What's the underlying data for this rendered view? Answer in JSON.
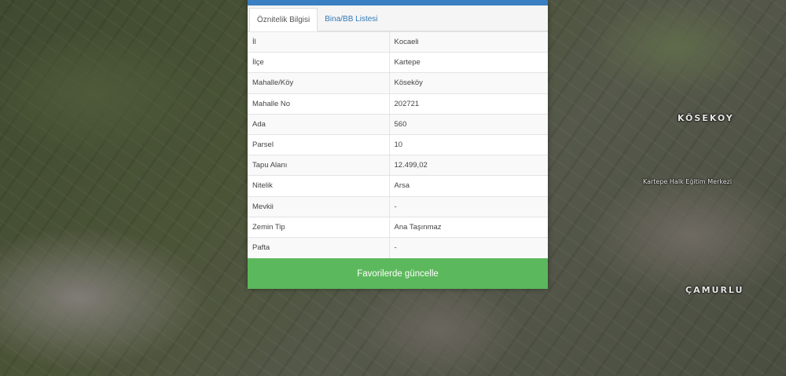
{
  "map": {
    "labels": [
      "KÖSEKOY",
      "ÇAMURLU",
      "Kartepe Halk Eğitim Merkezi"
    ]
  },
  "tabs": [
    {
      "label": "Öznitelik Bilgisi",
      "active": true
    },
    {
      "label": "Bina/BB Listesi",
      "active": false
    }
  ],
  "attributes": [
    {
      "key": "İl",
      "value": "Kocaeli"
    },
    {
      "key": "İlçe",
      "value": "Kartepe"
    },
    {
      "key": "Mahalle/Köy",
      "value": "Köseköy"
    },
    {
      "key": "Mahalle No",
      "value": "202721"
    },
    {
      "key": "Ada",
      "value": "560"
    },
    {
      "key": "Parsel",
      "value": "10"
    },
    {
      "key": "Tapu Alanı",
      "value": "12.499,02"
    },
    {
      "key": "Nitelik",
      "value": "Arsa"
    },
    {
      "key": "Mevkii",
      "value": "-"
    },
    {
      "key": "Zemin Tip",
      "value": "Ana Taşınmaz"
    },
    {
      "key": "Pafta",
      "value": "-"
    }
  ],
  "actions": {
    "update_favorites": "Favorilerde güncelle"
  },
  "colors": {
    "header_bar": "#3a7fc1",
    "button_green": "#5cb85c",
    "tab_link": "#337ab7"
  }
}
